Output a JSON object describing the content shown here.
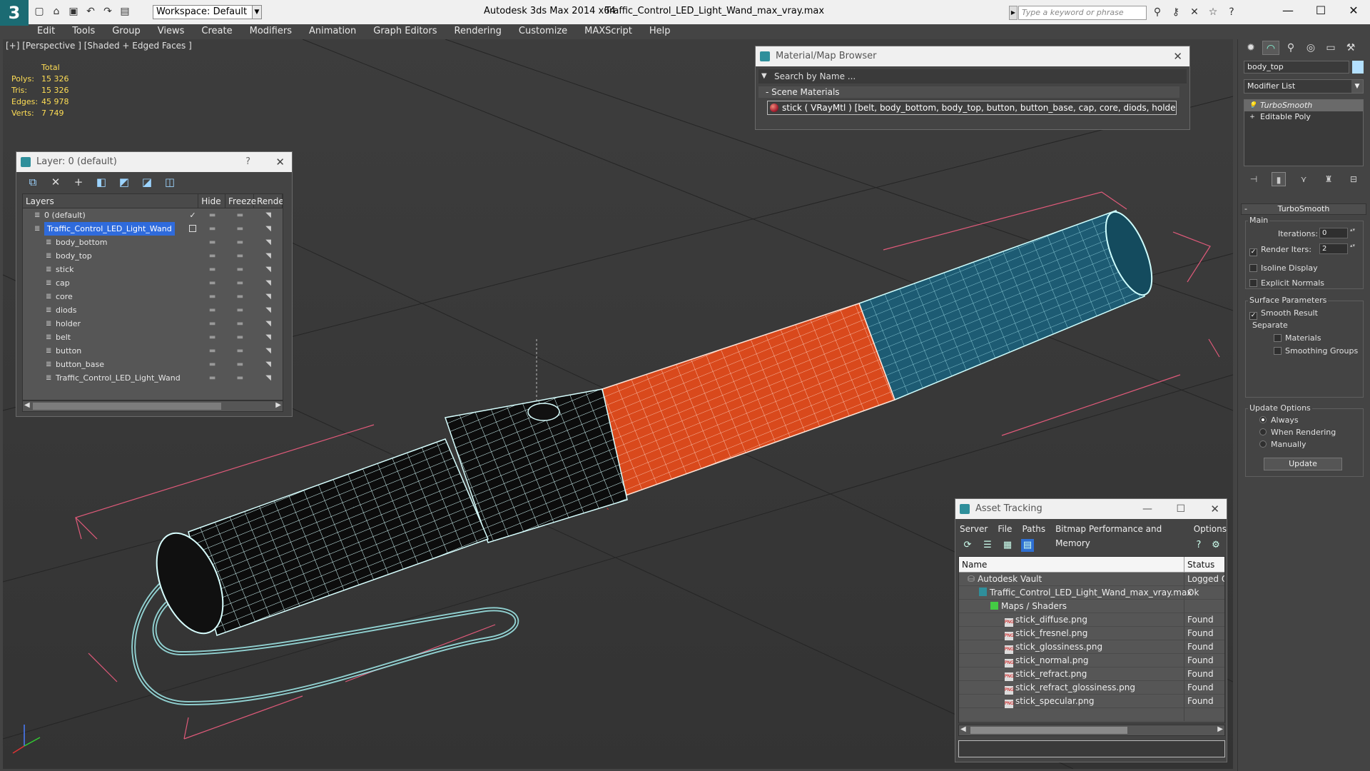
{
  "titlebar": {
    "workspace": "Workspace: Default",
    "app_title": "Autodesk 3ds Max  2014 x64",
    "file_title": "Traffic_Control_LED_Light_Wand_max_vray.max",
    "search_placeholder": "Type a keyword or phrase"
  },
  "menu": [
    "Edit",
    "Tools",
    "Group",
    "Views",
    "Create",
    "Modifiers",
    "Animation",
    "Graph Editors",
    "Rendering",
    "Customize",
    "MAXScript",
    "Help"
  ],
  "viewport": {
    "label": "[+] [Perspective ] [Shaded + Edged Faces ]",
    "stats": {
      "total_label": "Total",
      "rows": [
        {
          "k": "Polys:",
          "v": "15 326"
        },
        {
          "k": "Tris:",
          "v": "15 326"
        },
        {
          "k": "Edges:",
          "v": "45 978"
        },
        {
          "k": "Verts:",
          "v": "7 749"
        }
      ]
    }
  },
  "layer_dialog": {
    "title": "Layer: 0 (default)",
    "help": "?",
    "columns": [
      "Layers",
      "Hide",
      "Freeze",
      "Rende"
    ],
    "rows": [
      {
        "name": "0 (default)",
        "indent": 1,
        "check": "✓"
      },
      {
        "name": "Traffic_Control_LED_Light_Wand",
        "indent": 1,
        "selected": true
      },
      {
        "name": "body_bottom",
        "indent": 2
      },
      {
        "name": "body_top",
        "indent": 2
      },
      {
        "name": "stick",
        "indent": 2
      },
      {
        "name": "cap",
        "indent": 2
      },
      {
        "name": "core",
        "indent": 2
      },
      {
        "name": "diods",
        "indent": 2
      },
      {
        "name": "holder",
        "indent": 2
      },
      {
        "name": "belt",
        "indent": 2
      },
      {
        "name": "button",
        "indent": 2
      },
      {
        "name": "button_base",
        "indent": 2
      },
      {
        "name": "Traffic_Control_LED_Light_Wand",
        "indent": 2
      }
    ]
  },
  "material_browser": {
    "title": "Material/Map Browser",
    "search": "Search by Name ...",
    "section": "Scene Materials",
    "item": "stick  ( VRayMtl )  [belt, body_bottom, body_top, button, button_base, cap, core, diods, holder, stick]"
  },
  "asset_tracking": {
    "title": "Asset Tracking",
    "menu": [
      "Server",
      "File",
      "Paths",
      "Bitmap Performance and Memory",
      "Options"
    ],
    "columns": [
      "Name",
      "Status"
    ],
    "rows": [
      {
        "name": "Autodesk Vault",
        "status": "Logged O",
        "indent": 1
      },
      {
        "name": "Traffic_Control_LED_Light_Wand_max_vray.max",
        "status": "Ok",
        "indent": 2
      },
      {
        "name": "Maps / Shaders",
        "status": "",
        "indent": 3
      },
      {
        "name": "stick_diffuse.png",
        "status": "Found",
        "indent": 4
      },
      {
        "name": "stick_fresnel.png",
        "status": "Found",
        "indent": 4
      },
      {
        "name": "stick_glossiness.png",
        "status": "Found",
        "indent": 4
      },
      {
        "name": "stick_normal.png",
        "status": "Found",
        "indent": 4
      },
      {
        "name": "stick_refract.png",
        "status": "Found",
        "indent": 4
      },
      {
        "name": "stick_refract_glossiness.png",
        "status": "Found",
        "indent": 4
      },
      {
        "name": "stick_specular.png",
        "status": "Found",
        "indent": 4
      }
    ]
  },
  "command_panel": {
    "object_name": "body_top",
    "modifier_list": "Modifier List",
    "stack": [
      "TurboSmooth",
      "Editable Poly"
    ],
    "rollout_title": "TurboSmooth",
    "main_label": "Main",
    "iterations_label": "Iterations:",
    "iterations_value": "0",
    "render_iters_label": "Render Iters:",
    "render_iters_value": "2",
    "isoline": "Isoline Display",
    "explicit": "Explicit Normals",
    "surface_label": "Surface Parameters",
    "smooth_result": "Smooth Result",
    "separate_label": "Separate",
    "materials": "Materials",
    "smoothing_groups": "Smoothing Groups",
    "update_label": "Update Options",
    "always": "Always",
    "when_rendering": "When Rendering",
    "manually": "Manually",
    "update_button": "Update"
  },
  "colors": {
    "orange": "#d9491c",
    "teal": "#1d5b73",
    "wire": "#c8f4f4",
    "selection": "#2f6bdc"
  }
}
